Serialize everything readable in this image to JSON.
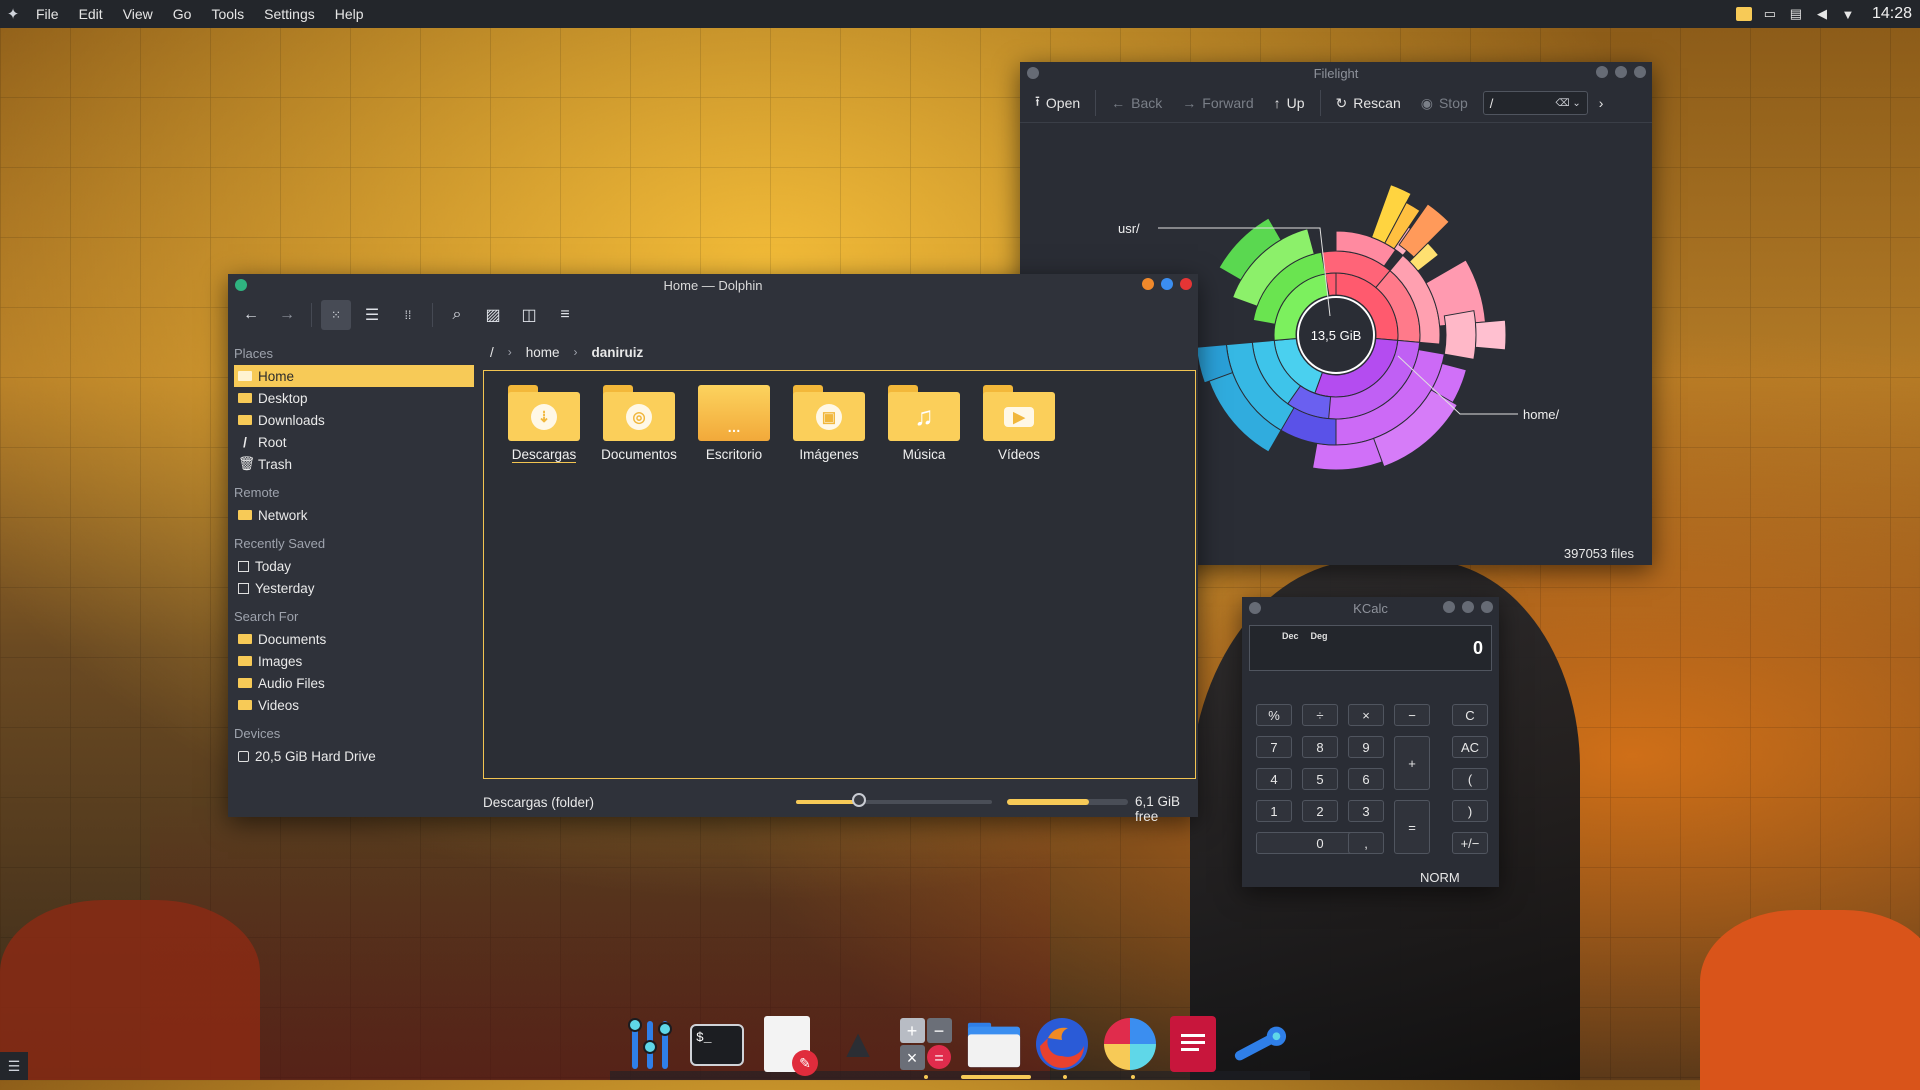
{
  "menubar": {
    "items": [
      "File",
      "Edit",
      "View",
      "Go",
      "Tools",
      "Settings",
      "Help"
    ],
    "clock": "14:28",
    "launcher_icon": "kde-launcher-icon",
    "tray_icons": [
      "dolphin-tray-icon",
      "display-icon",
      "clipboard-icon",
      "volume-icon",
      "tray-expand-icon"
    ]
  },
  "filelight": {
    "title": "Filelight",
    "toolbar": {
      "open": "Open",
      "back": "Back",
      "forward": "Forward",
      "up": "Up",
      "rescan": "Rescan",
      "stop": "Stop",
      "path": "/"
    },
    "center_label": "13,5 GiB",
    "callouts": {
      "usr": "usr/",
      "home": "home/"
    },
    "status": "397053 files"
  },
  "dolphin": {
    "title": "Home — Dolphin",
    "places": {
      "sections": [
        {
          "header": "Places",
          "items": [
            {
              "label": "Home",
              "icon": "home-folder-icon",
              "selected": true
            },
            {
              "label": "Desktop",
              "icon": "folder-icon"
            },
            {
              "label": "Downloads",
              "icon": "folder-icon"
            },
            {
              "label": "Root",
              "icon": "root-slash-icon"
            },
            {
              "label": "Trash",
              "icon": "trash-icon"
            }
          ]
        },
        {
          "header": "Remote",
          "items": [
            {
              "label": "Network",
              "icon": "folder-icon"
            }
          ]
        },
        {
          "header": "Recently Saved",
          "items": [
            {
              "label": "Today",
              "icon": "checkbox-icon"
            },
            {
              "label": "Yesterday",
              "icon": "checkbox-icon"
            }
          ]
        },
        {
          "header": "Search For",
          "items": [
            {
              "label": "Documents",
              "icon": "folder-icon"
            },
            {
              "label": "Images",
              "icon": "folder-icon"
            },
            {
              "label": "Audio Files",
              "icon": "folder-icon"
            },
            {
              "label": "Videos",
              "icon": "folder-icon"
            }
          ]
        },
        {
          "header": "Devices",
          "items": [
            {
              "label": "20,5 GiB Hard Drive",
              "icon": "harddrive-icon"
            }
          ]
        }
      ]
    },
    "breadcrumb": [
      "/",
      "home",
      "daniruiz"
    ],
    "folders": [
      {
        "name": "Descargas",
        "glyph": "⇣",
        "icon": "downloads-folder-icon",
        "focused": true
      },
      {
        "name": "Documentos",
        "glyph": "◎",
        "icon": "documents-folder-icon"
      },
      {
        "name": "Escritorio",
        "glyph": "…",
        "icon": "desktop-folder-icon"
      },
      {
        "name": "Imágenes",
        "glyph": "▣",
        "icon": "pictures-folder-icon"
      },
      {
        "name": "Música",
        "glyph": "♫",
        "icon": "music-folder-icon"
      },
      {
        "name": "Vídeos",
        "glyph": "▶",
        "icon": "videos-folder-icon"
      }
    ],
    "status_text": "Descargas (folder)",
    "zoom_fraction": 0.32,
    "used_fraction": 0.68,
    "free_space": "6,1 GiB free"
  },
  "kcalc": {
    "title": "KCalc",
    "mode_dec": "Dec",
    "mode_deg": "Deg",
    "display": "0",
    "keys": [
      "%",
      "÷",
      "×",
      "−",
      "C",
      "7",
      "8",
      "9",
      "+",
      "AC",
      "4",
      "5",
      "6",
      "(",
      "1",
      "2",
      "3",
      "=",
      ")",
      "0",
      ",",
      "+/−"
    ],
    "status": "NORM"
  },
  "dock": {
    "apps": [
      "mixer-icon",
      "terminal-icon",
      "text-editor-icon",
      "inkscape-icon",
      "calculator-icon",
      "file-manager-icon",
      "firefox-icon",
      "color-picker-icon",
      "document-viewer-icon",
      "system-settings-icon"
    ]
  },
  "colors": {
    "accent": "#f7ca57",
    "window_bg": "#2f323a",
    "topbar_bg": "#23262b"
  }
}
